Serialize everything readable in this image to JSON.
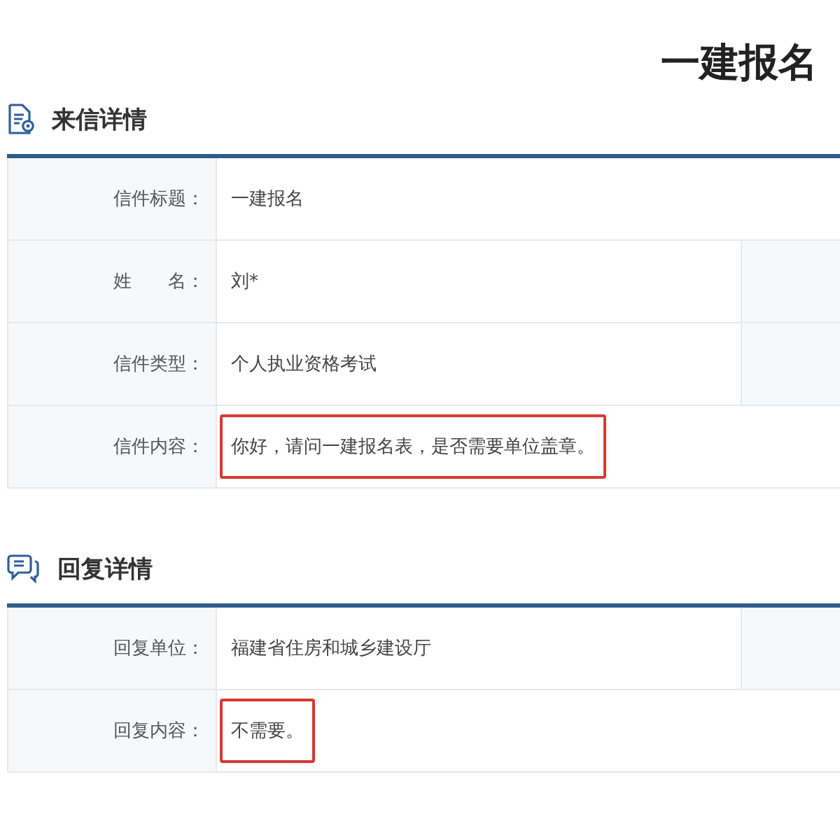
{
  "page_title": "一建报名",
  "sections": [
    {
      "title": "来信详情",
      "kind": "letter",
      "rows": [
        {
          "label": "信件标题：",
          "value": "一建报名",
          "extra_cell": false,
          "highlighted": false
        },
        {
          "label": "姓　　名：",
          "value": "刘*",
          "extra_cell": true,
          "highlighted": false
        },
        {
          "label": "信件类型：",
          "value": "个人执业资格考试",
          "extra_cell": true,
          "highlighted": false
        },
        {
          "label": "信件内容：",
          "value": "你好，请问一建报名表，是否需要单位盖章。",
          "extra_cell": false,
          "highlighted": true
        }
      ]
    },
    {
      "title": "回复详情",
      "kind": "reply",
      "rows": [
        {
          "label": "回复单位：",
          "value": "福建省住房和城乡建设厅",
          "extra_cell": true,
          "highlighted": false
        },
        {
          "label": "回复内容：",
          "value": "不需要。",
          "extra_cell": false,
          "highlighted": true
        }
      ]
    }
  ]
}
